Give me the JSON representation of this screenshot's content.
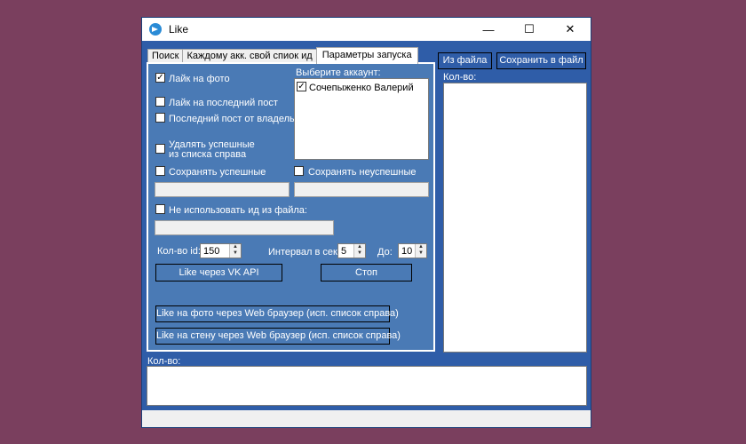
{
  "window": {
    "title": "Like",
    "minimize_symbol": "—",
    "maximize_symbol": "☐",
    "close_symbol": "✕"
  },
  "tabs": [
    {
      "label": "Поиск"
    },
    {
      "label": "Каждому акк. свой спиок ид"
    },
    {
      "label": "Параметры запуска",
      "active": true
    }
  ],
  "params": {
    "like_photo": {
      "label": "Лайк на фото",
      "checked": true
    },
    "like_last_post": {
      "label": "Лайк на последний пост",
      "checked": false
    },
    "last_post_owner": {
      "label": "Последний пост от владельца",
      "checked": false
    },
    "delete_success": {
      "label_line1": "Удалять успешные",
      "label_line2": "из списка справа",
      "checked": false
    },
    "save_success": {
      "label": "Сохранять успешные",
      "checked": false,
      "value": ""
    },
    "save_fail": {
      "label": "Сохранять неуспешные",
      "checked": false,
      "value": ""
    },
    "no_file_ids": {
      "label": "Не использовать ид из файла:",
      "checked": false,
      "value": ""
    },
    "account_label": "Выберите аккаунт:",
    "accounts": [
      {
        "name": "Сочепыженко Валерий",
        "checked": true
      }
    ],
    "count_label": "Кол-во id:",
    "count_value": "150",
    "interval_label": "Интервал в сек:",
    "interval_value": "5",
    "to_label": "До:",
    "to_value": "10",
    "btn_vk_api": "Like через VK API",
    "btn_stop": "Стоп",
    "btn_web_photo": "Like на фото через Web браузер (исп. список справа)",
    "btn_web_wall": "Like на стену через Web браузер (исп. список справа)"
  },
  "right_panel": {
    "btn_from_file": "Из файла",
    "btn_save_file": "Сохранить в файл",
    "count_label": "Кол-во:"
  },
  "bottom": {
    "count_label": "Кол-во:"
  },
  "icons": {
    "check": "✓",
    "spin_up": "▲",
    "spin_down": "▼"
  }
}
